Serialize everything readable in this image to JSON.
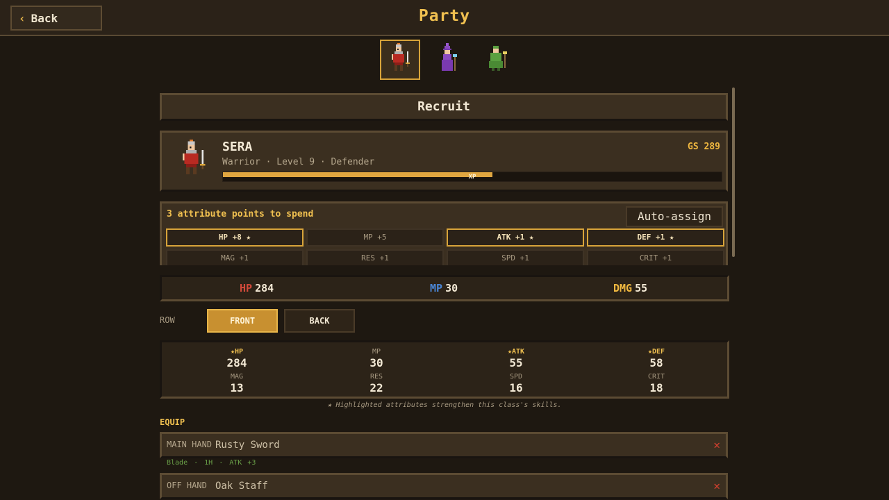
{
  "header": {
    "back_label": "Back",
    "title": "Party"
  },
  "party": [
    {
      "name": "warrior-portrait",
      "active": true
    },
    {
      "name": "mage-portrait",
      "active": false
    },
    {
      "name": "cleric-portrait",
      "active": false
    }
  ],
  "recruit_label": "Recruit",
  "hero": {
    "name": "SERA",
    "subtitle": "Warrior · Level 9 · Defender",
    "gs": "GS 289",
    "xp_label": "XP",
    "xp_progress": 0.54
  },
  "attributes": {
    "points_text": "3 attribute points to spend",
    "auto_assign": "Auto-assign",
    "buttons": [
      {
        "label": "HP +8 ★",
        "highlighted": true
      },
      {
        "label": "MP +5",
        "highlighted": false
      },
      {
        "label": "ATK +1 ★",
        "highlighted": true
      },
      {
        "label": "DEF +1 ★",
        "highlighted": true
      },
      {
        "label": "MAG +1",
        "highlighted": false
      },
      {
        "label": "RES +1",
        "highlighted": false
      },
      {
        "label": "SPD +1",
        "highlighted": false
      },
      {
        "label": "CRIT +1",
        "highlighted": false
      }
    ]
  },
  "summary": {
    "hp_label": "HP",
    "hp": "284",
    "mp_label": "MP",
    "mp": "30",
    "dmg_label": "DMG",
    "dmg": "55"
  },
  "row": {
    "label": "ROW",
    "front": "FRONT",
    "back": "BACK",
    "selected": "FRONT"
  },
  "stats": [
    {
      "label": "★HP",
      "value": "284",
      "highlighted": true
    },
    {
      "label": "MP",
      "value": "30",
      "highlighted": false
    },
    {
      "label": "★ATK",
      "value": "55",
      "highlighted": true
    },
    {
      "label": "★DEF",
      "value": "58",
      "highlighted": true
    },
    {
      "label": "MAG",
      "value": "13",
      "highlighted": false
    },
    {
      "label": "RES",
      "value": "22",
      "highlighted": false
    },
    {
      "label": "SPD",
      "value": "16",
      "highlighted": false
    },
    {
      "label": "CRIT",
      "value": "18",
      "highlighted": false
    }
  ],
  "stats_note": "★ Highlighted attributes strengthen this class's skills.",
  "equip": {
    "title": "EQUIP",
    "main_hand": {
      "slot": "MAIN HAND",
      "item": "Rusty Sword",
      "meta": [
        "Blade",
        "1H",
        "ATK +3"
      ]
    },
    "off_hand": {
      "slot": "OFF HAND",
      "item": "Oak Staff"
    },
    "remove_symbol": "✕"
  },
  "colors": {
    "accent": "#f0c050",
    "hp": "#d24a3a",
    "mp": "#4a86d6",
    "remove": "#d8402f",
    "meta_green": "#6aa048"
  }
}
